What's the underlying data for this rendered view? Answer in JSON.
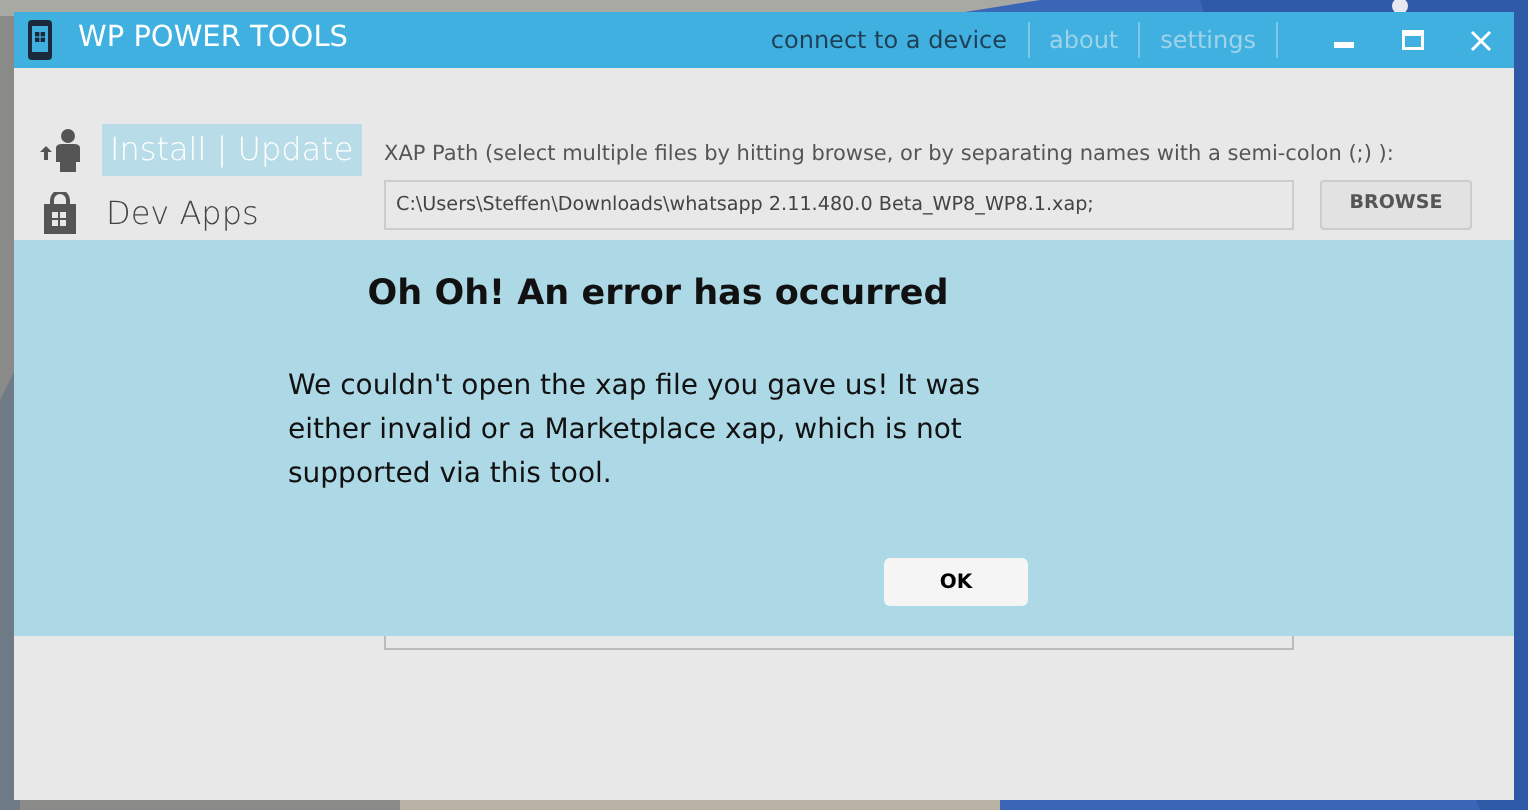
{
  "window": {
    "title": "WP POWER TOOLS"
  },
  "header_links": [
    {
      "label": "connect to a device",
      "disabled": false
    },
    {
      "label": "about",
      "disabled": true
    },
    {
      "label": "settings",
      "disabled": true
    }
  ],
  "sidebar": {
    "items": [
      {
        "label": "Install | Update",
        "selected": true,
        "kind": "install"
      },
      {
        "label": "Dev Apps",
        "selected": false,
        "kind": "apps"
      }
    ]
  },
  "xap_path": {
    "label": "XAP Path (select multiple files by hitting browse, or by separating names with a semi-colon (;) ):",
    "value": "C:\\Users\\Steffen\\Downloads\\whatsapp 2.11.480.0 Beta_WP8_WP8.1.xap;",
    "button": "BROWSE"
  },
  "dialog": {
    "title": "Oh Oh! An error has occurred",
    "message": "We couldn't open the xap file you gave us! It was either invalid or a Marketplace xap, which is not supported via this tool.",
    "button": "OK"
  }
}
